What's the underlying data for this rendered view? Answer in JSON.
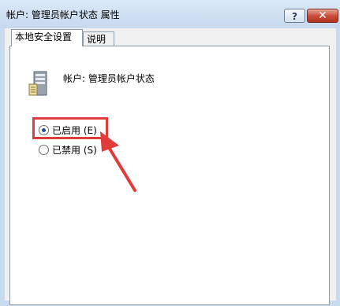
{
  "window": {
    "title": "帐户: 管理员帐户状态 属性",
    "help_label": "?",
    "close_label": "✕"
  },
  "tabs": [
    {
      "label": "本地安全设置",
      "active": true
    },
    {
      "label": "说明",
      "active": false
    }
  ],
  "policy": {
    "icon": "server-policy-icon",
    "heading": "帐户: 管理员帐户状态"
  },
  "options": [
    {
      "label": "已启用 (E)",
      "selected": true
    },
    {
      "label": "已禁用 (S)",
      "selected": false
    }
  ],
  "annotation": {
    "highlight_color": "#e03c3c"
  }
}
